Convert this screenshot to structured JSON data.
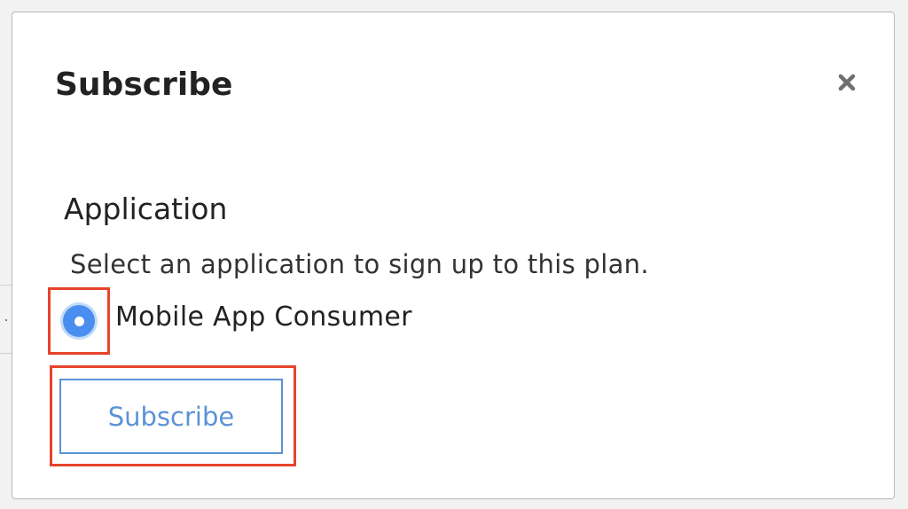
{
  "modal": {
    "title": "Subscribe",
    "close_icon": "close-icon",
    "section_heading": "Application",
    "description": "Select an application to sign up to this plan.",
    "options": [
      {
        "label": "Mobile App Consumer",
        "selected": true
      }
    ],
    "submit_label": "Subscribe"
  },
  "colors": {
    "radio_selected": "#4a8ef0",
    "button_text": "#5b93d6",
    "highlight_border": "#e5442b"
  }
}
